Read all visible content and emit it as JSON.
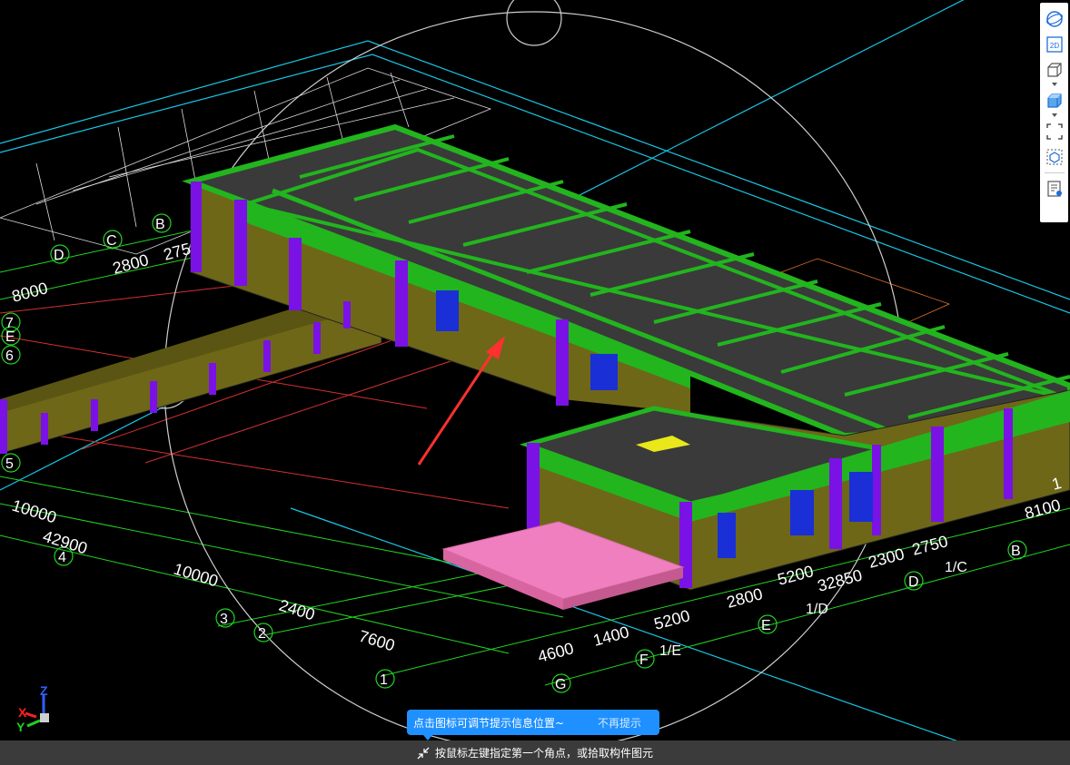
{
  "colors": {
    "background": "#000000",
    "slab": "#3a3a3a",
    "beam": "#22b51e",
    "wall": "#6e6718",
    "column": "#7a12e6",
    "steps": "#f07fc0",
    "tip_bg": "#1e90ff",
    "status_bg": "#3b3b3b"
  },
  "grid_axes": [
    "D",
    "C",
    "B",
    "7",
    "E",
    "6",
    "5",
    "4",
    "3",
    "2",
    "1",
    "G",
    "F",
    "E",
    "1/E",
    "1/D",
    "D",
    "1/C",
    "B"
  ],
  "dimensions": [
    "2800",
    "275",
    "8000",
    "10000",
    "42900",
    "10000",
    "2400",
    "7600",
    "4600",
    "1400",
    "5200",
    "2800",
    "1/E",
    "32850",
    "5200",
    "2300",
    "2750",
    "8100",
    "1/C",
    "1/D",
    "1"
  ],
  "triad": {
    "x": "X",
    "y": "Y",
    "z": "Z"
  },
  "toolbar": {
    "items": [
      "orbit-icon",
      "view-2d-icon",
      "wireframe-box-icon",
      "shaded-box-icon",
      "fit-extents-icon",
      "isolate-icon",
      "properties-icon"
    ],
    "view_2d_label": "2D"
  },
  "tip": {
    "message": "点击图标可调节提示信息位置~",
    "dismiss": "不再提示"
  },
  "status": {
    "prompt": "按鼠标左键指定第一个角点，或拾取构件图元"
  }
}
